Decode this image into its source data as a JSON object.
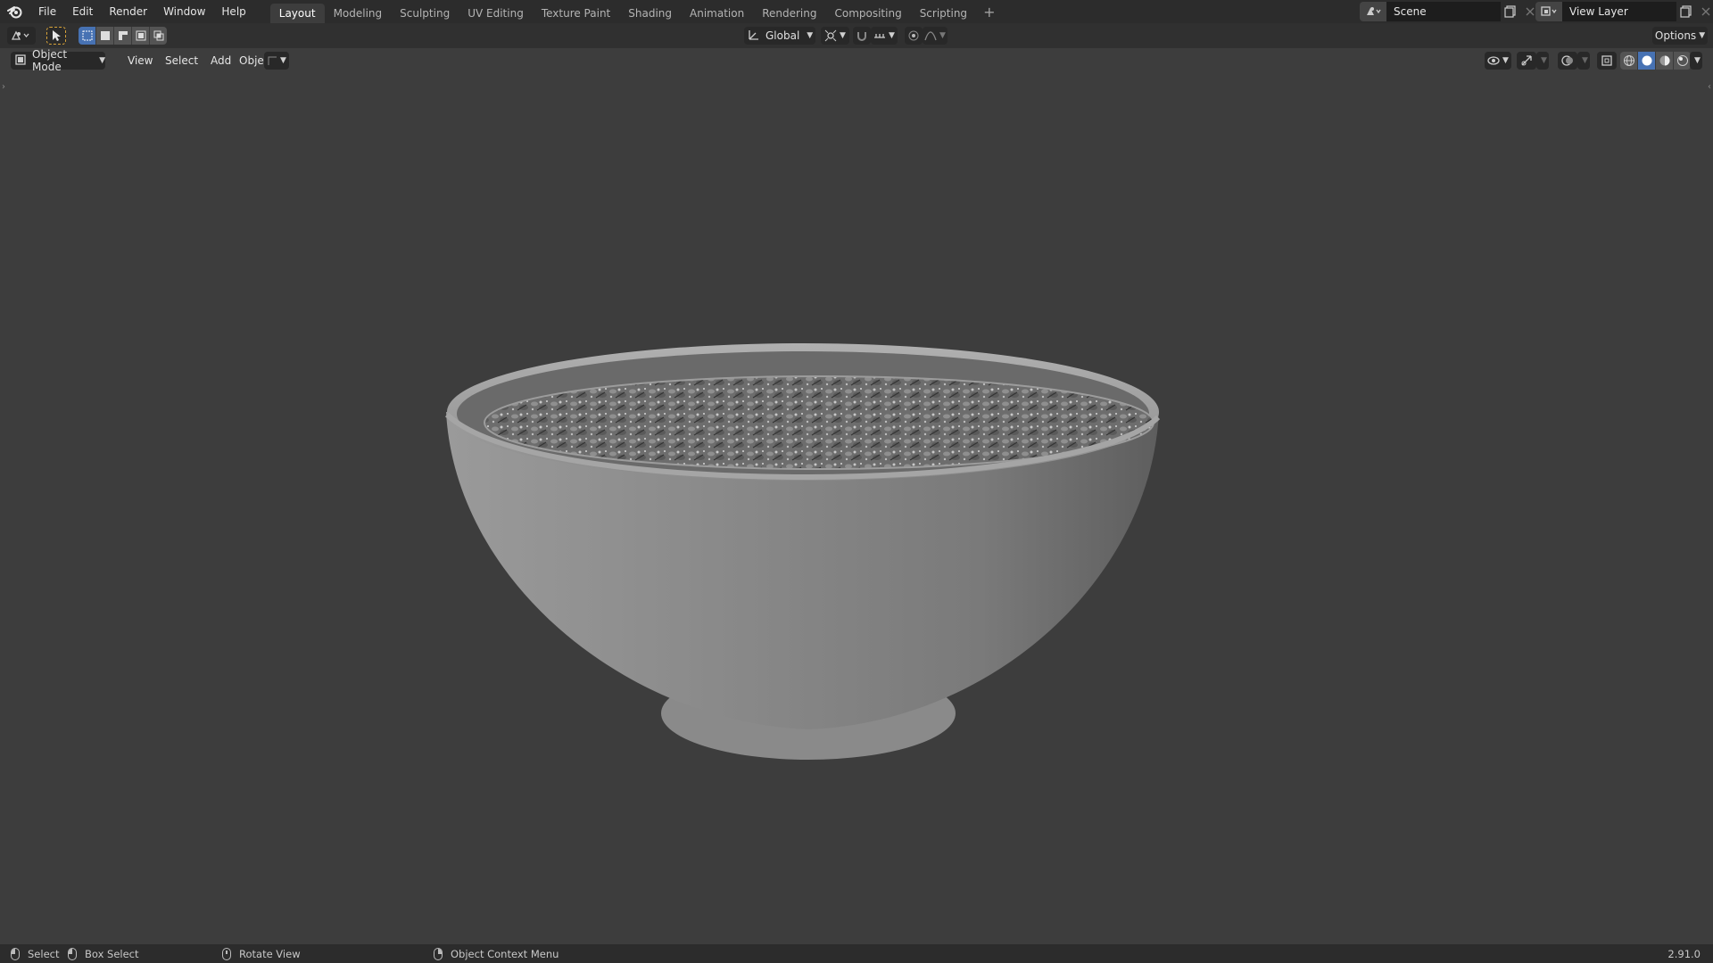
{
  "menu": [
    "File",
    "Edit",
    "Render",
    "Window",
    "Help"
  ],
  "workspace_tabs": [
    {
      "label": "Layout",
      "active": true
    },
    {
      "label": "Modeling",
      "active": false
    },
    {
      "label": "Sculpting",
      "active": false
    },
    {
      "label": "UV Editing",
      "active": false
    },
    {
      "label": "Texture Paint",
      "active": false
    },
    {
      "label": "Shading",
      "active": false
    },
    {
      "label": "Animation",
      "active": false
    },
    {
      "label": "Rendering",
      "active": false
    },
    {
      "label": "Compositing",
      "active": false
    },
    {
      "label": "Scripting",
      "active": false
    }
  ],
  "add_workspace": "+",
  "scene": {
    "name": "Scene",
    "icon": "scene-icon"
  },
  "view_layer": {
    "name": "View Layer",
    "icon": "view-layer-icon"
  },
  "toolbar": {
    "transform_orientation": "Global",
    "options_label": "Options",
    "select_mode_active": 0
  },
  "viewport_header": {
    "mode": "Object Mode",
    "menus": [
      "View",
      "Select",
      "Add",
      "Object"
    ],
    "shading_active": "solid"
  },
  "statusbar": {
    "items": [
      {
        "icon": "mouse-left-icon",
        "label": "Select"
      },
      {
        "icon": "mouse-drag-icon",
        "label": "Box Select"
      },
      {
        "icon": "mouse-middle-icon",
        "label": "Rotate View"
      },
      {
        "icon": "mouse-right-icon",
        "label": "Object Context Menu"
      }
    ],
    "version": "2.91.0"
  },
  "colors": {
    "topbar": "#2c2c2c",
    "viewport_bg": "#3d3d3d",
    "active_blue": "#4772b3",
    "bowl": "#8a8a8a"
  }
}
